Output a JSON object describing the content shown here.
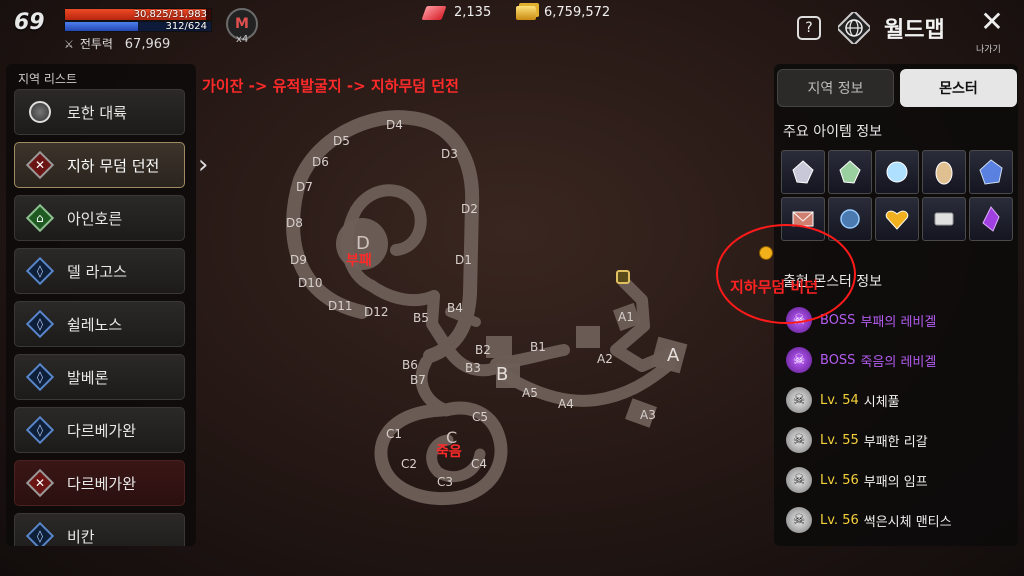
{
  "player": {
    "level": "69",
    "hp_text": "30,825/31,983",
    "hp_fraction": 0.964,
    "mp_text": "312/624",
    "mp_fraction": 0.5,
    "combat_power_label": "전투력",
    "combat_power": "67,969",
    "badge_letter": "M",
    "badge_multiplier": "x4"
  },
  "currency": {
    "gems": "2,135",
    "gold": "6,759,572"
  },
  "header": {
    "help_label": "?",
    "title": "월드맵",
    "close_glyph": "✕",
    "exit_label": "나가기"
  },
  "region_list": {
    "title": "지역 리스트",
    "items": [
      {
        "label": "로한 대륙",
        "icon": "globe-icon",
        "state": "normal"
      },
      {
        "label": "지하 무덤 던전",
        "icon": "crossed-swords-icon",
        "state": "selected"
      },
      {
        "label": "아인호른",
        "icon": "home-icon",
        "state": "normal"
      },
      {
        "label": "델 라고스",
        "icon": "shield-icon",
        "state": "normal"
      },
      {
        "label": "쉴레노스",
        "icon": "shield-icon",
        "state": "normal"
      },
      {
        "label": "발베론",
        "icon": "shield-icon",
        "state": "normal"
      },
      {
        "label": "다르베가완",
        "icon": "shield-icon",
        "state": "normal"
      },
      {
        "label": "다르베가완",
        "icon": "crossed-swords-icon",
        "state": "danger"
      },
      {
        "label": "비칸",
        "icon": "shield-icon",
        "state": "normal"
      }
    ]
  },
  "map": {
    "route_annotation": "가이잔 -> 유적발굴지 -> 지하무덤 던전",
    "zone_labels": {
      "D": "D",
      "D_name": "부패",
      "C": "C",
      "C_name": "죽음",
      "B": "B",
      "A": "A"
    },
    "nodes": [
      "D1",
      "D2",
      "D3",
      "D4",
      "D5",
      "D6",
      "D7",
      "D8",
      "D9",
      "D10",
      "D11",
      "D12",
      "B1",
      "B2",
      "B3",
      "B4",
      "B5",
      "B6",
      "B7",
      "A1",
      "A2",
      "A3",
      "A4",
      "A5",
      "C1",
      "C2",
      "C3",
      "C4",
      "C5"
    ],
    "secret_annotation": "지하무덤 비던"
  },
  "right_panel": {
    "tab_region": "지역 정보",
    "tab_monster": "몬스터",
    "items_title": "주요 아이템 정보",
    "monsters_title": "출현 몬스터 정보",
    "items": [
      {
        "icon": "crystal-white-icon",
        "color": "#c8c8d8"
      },
      {
        "icon": "crystal-green-icon",
        "color": "#9ad0a0"
      },
      {
        "icon": "crystal-orb-icon",
        "color": "#b0e0ff"
      },
      {
        "icon": "egg-icon",
        "color": "#e0c090"
      },
      {
        "icon": "crystal-blue-icon",
        "color": "#5a80e0"
      },
      {
        "icon": "envelope-icon",
        "color": "#d08070"
      },
      {
        "icon": "blue-orb-icon",
        "color": "#4a7ab0"
      },
      {
        "icon": "gold-heart-icon",
        "color": "#f0b020"
      },
      {
        "icon": "scroll-icon",
        "color": "#e0e0e0"
      },
      {
        "icon": "purple-crystal-icon",
        "color": "#a040e0"
      }
    ],
    "monsters": [
      {
        "tag": "BOSS",
        "name": "부패의 레비겔",
        "kind": "boss"
      },
      {
        "tag": "BOSS",
        "name": "죽음의 레비겔",
        "kind": "boss"
      },
      {
        "tag": "Lv. 54",
        "name": "시체풀",
        "kind": "normal"
      },
      {
        "tag": "Lv. 55",
        "name": "부패한 리갈",
        "kind": "normal"
      },
      {
        "tag": "Lv. 56",
        "name": "부패의 임프",
        "kind": "normal"
      },
      {
        "tag": "Lv. 56",
        "name": "썩은시체 맨티스",
        "kind": "normal"
      }
    ]
  },
  "colors": {
    "annotation_red": "#ff2a2a",
    "boss_purple": "#b45cf0",
    "level_yellow": "#f4d23a",
    "hp_red": "#e03a1c",
    "mp_blue": "#3a66d8"
  }
}
